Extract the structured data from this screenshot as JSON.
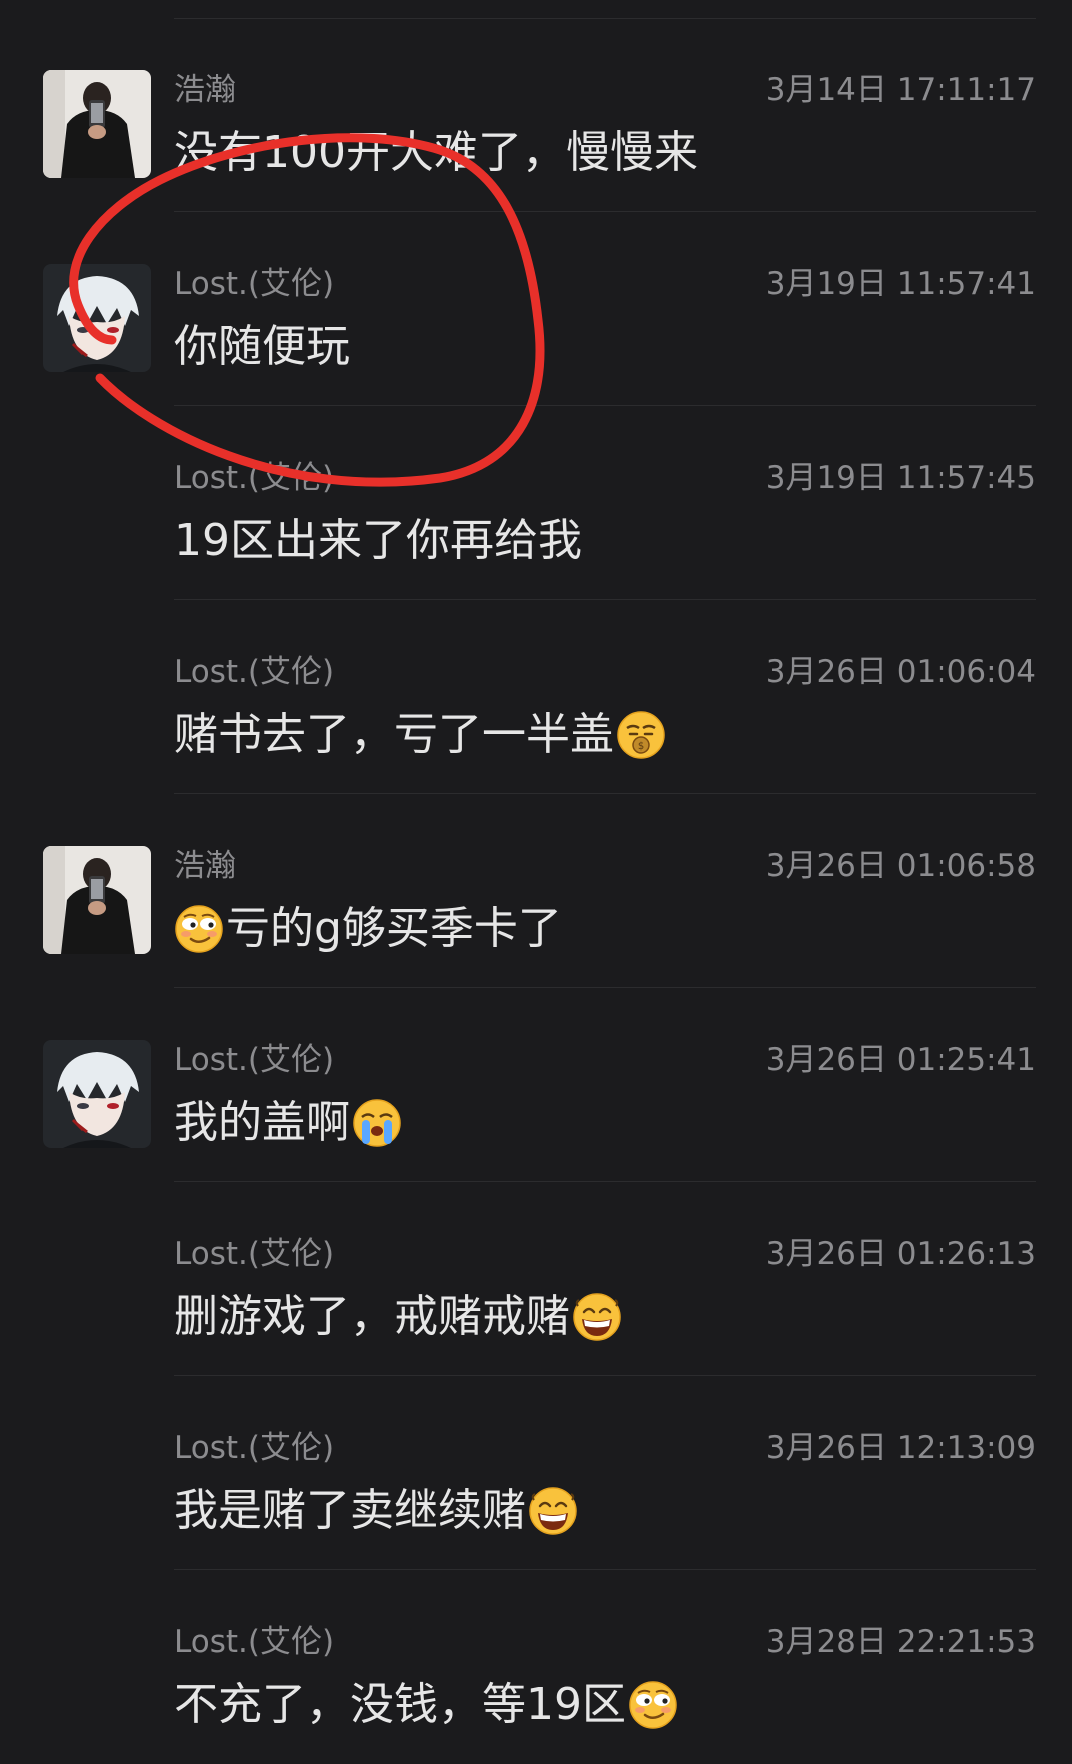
{
  "messages": [
    {
      "sender": "浩瀚",
      "time": "3月14日 17:11:17",
      "text": "没有100开大难了，慢慢来",
      "avatar": "person-avatar",
      "emoji_lead": null,
      "emoji_trail": null
    },
    {
      "sender": "Lost.(艾伦)",
      "time": "3月19日 11:57:41",
      "text": "你随便玩",
      "avatar": "anime-avatar",
      "emoji_lead": null,
      "emoji_trail": null
    },
    {
      "sender": "Lost.(艾伦)",
      "time": "3月19日 11:57:45",
      "text": "19区出来了你再给我",
      "avatar": null,
      "emoji_lead": null,
      "emoji_trail": null
    },
    {
      "sender": "Lost.(艾伦)",
      "time": "3月26日 01:06:04",
      "text": "赌书去了，亏了一半盖",
      "avatar": null,
      "emoji_lead": null,
      "emoji_trail": "money-mouth-emoji"
    },
    {
      "sender": "浩瀚",
      "time": "3月26日 01:06:58",
      "text": "亏的g够买季卡了",
      "avatar": "person-avatar",
      "emoji_lead": "smirk-emoji",
      "emoji_trail": null
    },
    {
      "sender": "Lost.(艾伦)",
      "time": "3月26日 01:25:41",
      "text": "我的盖啊",
      "avatar": "anime-avatar",
      "emoji_lead": null,
      "emoji_trail": "crying-emoji"
    },
    {
      "sender": "Lost.(艾伦)",
      "time": "3月26日 01:26:13",
      "text": "删游戏了，戒赌戒赌",
      "avatar": null,
      "emoji_lead": null,
      "emoji_trail": "grin-emoji"
    },
    {
      "sender": "Lost.(艾伦)",
      "time": "3月26日 12:13:09",
      "text": "我是赌了卖继续赌",
      "avatar": null,
      "emoji_lead": null,
      "emoji_trail": "grin-emoji"
    },
    {
      "sender": "Lost.(艾伦)",
      "time": "3月28日 22:21:53",
      "text": "不充了，没钱，等19区",
      "avatar": null,
      "emoji_lead": null,
      "emoji_trail": "smirk-emoji"
    }
  ],
  "colors": {
    "background": "#1b1b1d",
    "meta_text": "#8c8c8f",
    "message_text": "#e6e6e6",
    "divider": "#2c2c2e",
    "annotation": "#e8302a"
  }
}
